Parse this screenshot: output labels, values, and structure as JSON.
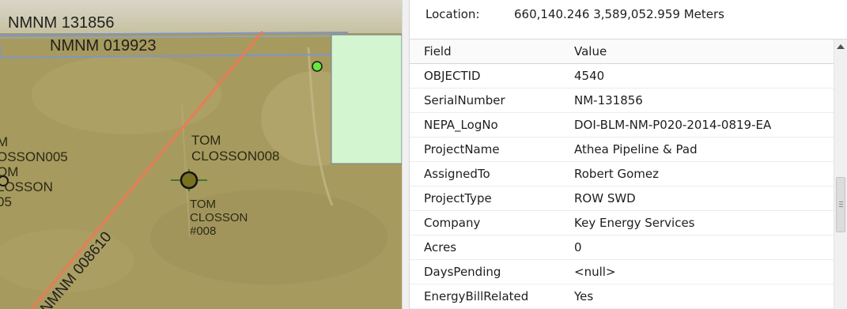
{
  "map": {
    "parcel_labels": [
      "NMNM 131856",
      "NMNM 019923",
      "NMNM 008610"
    ],
    "well_labels": {
      "left_upper": "M\nOSSON005\nOM\nLOSSON\n05",
      "tom_closson_008": "TOM\nCLOSSON008",
      "tom_closson_hash008": "TOM\nCLOSSON\n#008"
    },
    "colors": {
      "terrain": "#a79a5e",
      "pipeline": "#e87c55",
      "parcel_line": "#7e95c8",
      "selected_parcel": "#d3f5cf",
      "well_point_green": "#66e83a"
    }
  },
  "panel": {
    "location_label": "Location:",
    "location_value": "660,140.246  3,589,052.959 Meters",
    "columns": [
      "Field",
      "Value"
    ],
    "rows": [
      {
        "field": "OBJECTID",
        "value": "4540"
      },
      {
        "field": "SerialNumber",
        "value": "NM-131856"
      },
      {
        "field": "NEPA_LogNo",
        "value": "DOI-BLM-NM-P020-2014-0819-EA"
      },
      {
        "field": "ProjectName",
        "value": "Athea Pipeline & Pad"
      },
      {
        "field": "AssignedTo",
        "value": "Robert Gomez"
      },
      {
        "field": "ProjectType",
        "value": "ROW SWD"
      },
      {
        "field": "Company",
        "value": "Key Energy Services"
      },
      {
        "field": "Acres",
        "value": "0"
      },
      {
        "field": "DaysPending",
        "value": "<null>"
      },
      {
        "field": "EnergyBillRelated",
        "value": "Yes"
      }
    ]
  }
}
